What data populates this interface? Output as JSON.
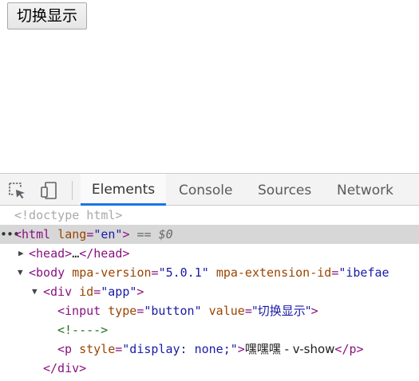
{
  "page": {
    "toggle_button_label": "切换显示"
  },
  "devtools": {
    "tabs": [
      {
        "label": "Elements",
        "active": true
      },
      {
        "label": "Console",
        "active": false
      },
      {
        "label": "Sources",
        "active": false
      },
      {
        "label": "Network",
        "active": false
      }
    ],
    "tools": {
      "inspect": "inspect-element-icon",
      "device": "device-toolbar-icon"
    },
    "dom": {
      "doctype": "<!doctype html>",
      "html_open": "<html",
      "html_attr": "lang",
      "html_attr_val": "\"en\"",
      "html_close": ">",
      "selected_marker": "==",
      "selected_var": "$0",
      "head_open": "<head>",
      "head_ellipsis": "…",
      "head_close": "</head>",
      "body_open": "<body",
      "body_attr1": "mpa-version",
      "body_attr1_val": "\"5.0.1\"",
      "body_attr2": "mpa-extension-id",
      "body_attr2_val": "\"ibefae",
      "div_open": "<div",
      "div_attr": "id",
      "div_attr_val": "\"app\"",
      "div_close_bracket": ">",
      "input_open": "<input",
      "input_attr1": "type",
      "input_attr1_val": "\"button\"",
      "input_attr2": "value",
      "input_attr2_val": "\"切换显示\"",
      "input_close": ">",
      "comment": "<!---->",
      "p_open": "<p",
      "p_attr": "style",
      "p_attr_val": "\"display: none;\"",
      "p_bracket": ">",
      "p_text": "嘿嘿嘿 - v-show",
      "p_close": "</p>",
      "div_close": "</div>"
    }
  },
  "colors": {
    "tag": "#881280",
    "attr_name": "#994500",
    "attr_value": "#1a1aa6",
    "comment": "#236e25",
    "doctype": "#a9a9a9",
    "active_tab_underline": "#1a73e8",
    "selected_row": "#d7d7d7"
  }
}
